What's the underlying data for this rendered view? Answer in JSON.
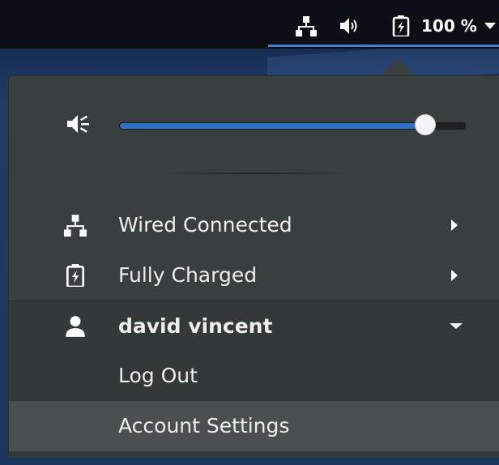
{
  "top_bar": {
    "network_icon": "network-wired-icon",
    "volume_icon": "audio-volume-high-icon",
    "battery_icon": "battery-full-charged-icon",
    "battery_percent": "100 %",
    "menu_arrow_icon": "pan-down-icon"
  },
  "menu": {
    "volume": {
      "icon": "audio-volume-low-icon",
      "level": 0.9
    },
    "items": [
      {
        "icon": "network-wired-icon",
        "label": "Wired Connected",
        "has_submenu": true
      },
      {
        "icon": "battery-full-charged-icon",
        "label": "Fully Charged",
        "has_submenu": true
      },
      {
        "icon": "user-icon",
        "label": "david vincent",
        "expanded": true
      },
      {
        "label": "Log Out"
      },
      {
        "label": "Account Settings"
      }
    ]
  },
  "colors": {
    "accent": "#2f71c4",
    "menu_bg": "#393f3f",
    "submenu_bg": "#333838",
    "hover_bg": "#4a5050",
    "text": "#eeeeec",
    "top_bar_bg": "#0c0f16"
  }
}
